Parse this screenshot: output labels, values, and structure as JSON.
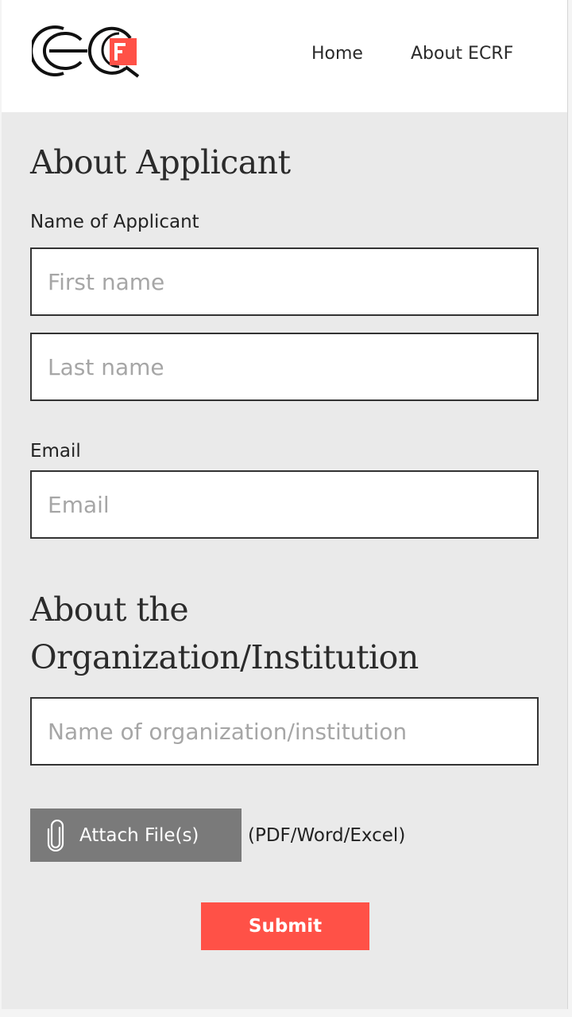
{
  "header": {
    "logo_name": "ECRF logo",
    "nav": [
      {
        "label": "Home"
      },
      {
        "label": "About ECRF"
      }
    ]
  },
  "applicant_section": {
    "title": "About Applicant",
    "name_label": "Name of Applicant",
    "first_name": {
      "value": "",
      "placeholder": "First name"
    },
    "last_name": {
      "value": "",
      "placeholder": "Last name"
    },
    "email_label": "Email",
    "email": {
      "value": "",
      "placeholder": "Email"
    }
  },
  "organization_section": {
    "title": "About the Organization/Institution",
    "org_name": {
      "value": "",
      "placeholder": "Name of organization/institution"
    }
  },
  "attachment": {
    "button_label": "Attach File(s)",
    "icon": "paperclip-icon",
    "hint": "(PDF/Word/Excel)"
  },
  "submit": {
    "label": "Submit"
  },
  "colors": {
    "accent": "#ff5147",
    "page_background": "#eaeaea",
    "header_background": "#ffffff",
    "attach_button": "#7a7a7a"
  }
}
